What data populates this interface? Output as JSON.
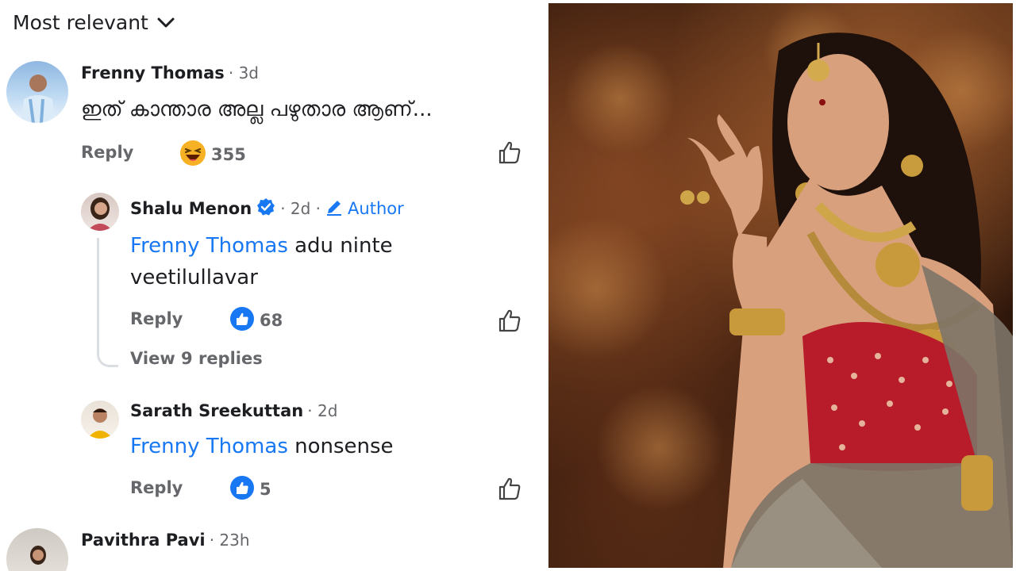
{
  "sort_label": "Most relevant",
  "comments": [
    {
      "name": "Frenny Thomas",
      "time": "· 3d",
      "text": "ഇത് കാന്താര അല്ല പഴുതാര ആണ്...",
      "reply_label": "Reply",
      "reaction": "haha",
      "reaction_count": "355"
    },
    {
      "name": "Shalu Menon",
      "time": "· 2d ·",
      "badge": "Author",
      "mention": "Frenny Thomas",
      "text_line1": " adu ninte",
      "text_line2": "veetilullavar",
      "reply_label": "Reply",
      "reaction": "like",
      "reaction_count": "68",
      "view_replies": "View 9 replies"
    },
    {
      "name": "Sarath Sreekuttan",
      "time": "· 2d",
      "mention": "Frenny Thomas",
      "text": " nonsense",
      "reply_label": "Reply",
      "reaction": "like",
      "reaction_count": "5"
    },
    {
      "name": "Pavithra Pavi",
      "time": "· 23h"
    }
  ],
  "colors": {
    "link_blue": "#1877f2",
    "text_dark": "#1c1e21",
    "text_gray": "#65676b",
    "haha_yellow": "#f7b125"
  }
}
